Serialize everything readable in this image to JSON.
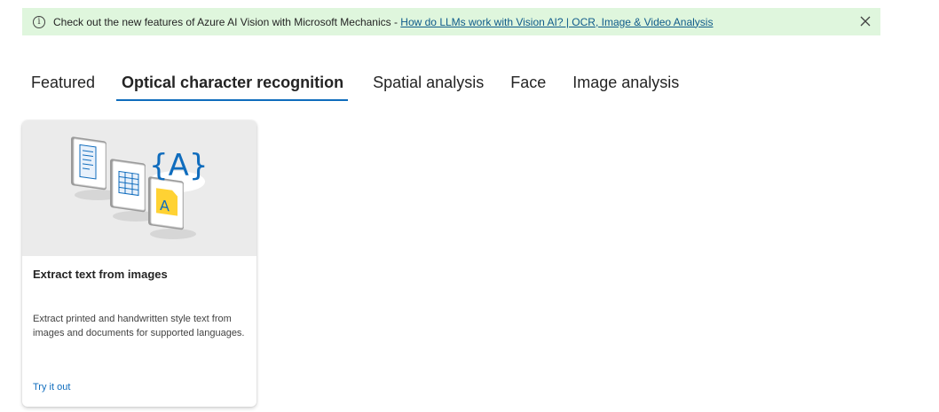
{
  "banner": {
    "icon": "info-icon",
    "message": "Check out the new features of Azure AI Vision with Microsoft Mechanics - ",
    "link_text": "How do LLMs work with Vision AI? | OCR, Image & Video Analysis",
    "close_icon": "close-icon",
    "background": "#dff6dd"
  },
  "tabs": [
    {
      "label": "Featured",
      "active": false
    },
    {
      "label": "Optical character recognition",
      "active": true
    },
    {
      "label": "Spatial analysis",
      "active": false
    },
    {
      "label": "Face",
      "active": false
    },
    {
      "label": "Image analysis",
      "active": false
    }
  ],
  "cards": [
    {
      "illustration": "ocr-illustration",
      "glyph": "{A}",
      "doc_letter": "A",
      "title": "Extract text from images",
      "description": "Extract printed and handwritten style text from images and documents for supported languages.",
      "link": "Try it out"
    }
  ],
  "colors": {
    "accent": "#0f6cbd",
    "link": "#0f5b8a"
  }
}
